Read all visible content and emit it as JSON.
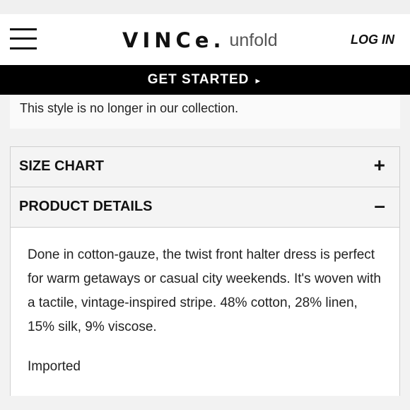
{
  "header": {
    "logo_main": "VINCe.",
    "logo_sub": "unfold",
    "login_label": "LOG IN"
  },
  "banner": {
    "label": "GET STARTED",
    "arrow": "►"
  },
  "notice": {
    "text": "This style is no longer in our collection."
  },
  "accordion": [
    {
      "label": "SIZE CHART",
      "sign": "+"
    },
    {
      "label": "PRODUCT DETAILS",
      "sign": "–"
    }
  ],
  "details": {
    "description": "Done in cotton-gauze, the twist front halter dress is perfect for warm getaways or casual city weekends. It's woven with a tactile, vintage-inspired stripe. 48% cotton, 28% linen, 15% silk, 9% viscose.",
    "origin": "Imported"
  }
}
